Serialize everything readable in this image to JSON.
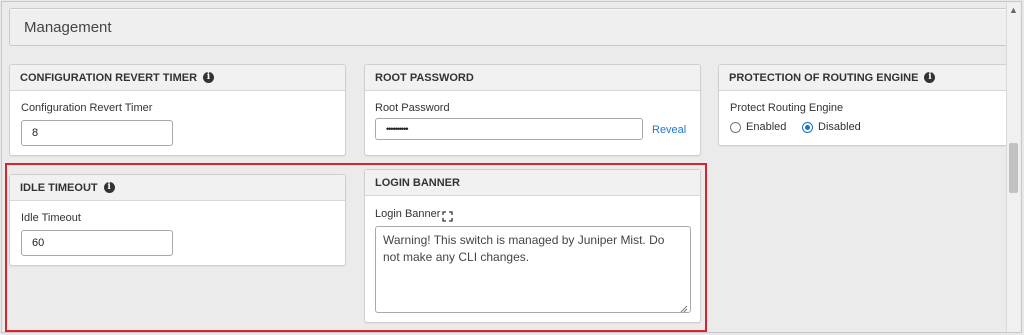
{
  "section": {
    "title": "Management"
  },
  "revert_timer": {
    "header": "CONFIGURATION REVERT TIMER",
    "label": "Configuration Revert Timer",
    "value": "8"
  },
  "root_password": {
    "header": "ROOT PASSWORD",
    "label": "Root Password",
    "value": "••••••••••",
    "reveal_label": "Reveal"
  },
  "protection": {
    "header": "PROTECTION OF ROUTING ENGINE",
    "label": "Protect Routing Engine",
    "options": [
      {
        "label": "Enabled",
        "selected": false
      },
      {
        "label": "Disabled",
        "selected": true
      }
    ]
  },
  "idle_timeout": {
    "header": "IDLE TIMEOUT",
    "label": "Idle Timeout",
    "value": "60"
  },
  "login_banner": {
    "header": "LOGIN BANNER",
    "label": "Login Banner",
    "value": "Warning! This switch is managed by Juniper Mist. Do not make any CLI changes."
  },
  "colors": {
    "accent": "#1a73c7",
    "highlight": "#d9232d",
    "link": "#1f77c9"
  },
  "icons": {
    "info": "info-icon",
    "expand": "expand-icon",
    "resize": "resize-grip-icon"
  }
}
